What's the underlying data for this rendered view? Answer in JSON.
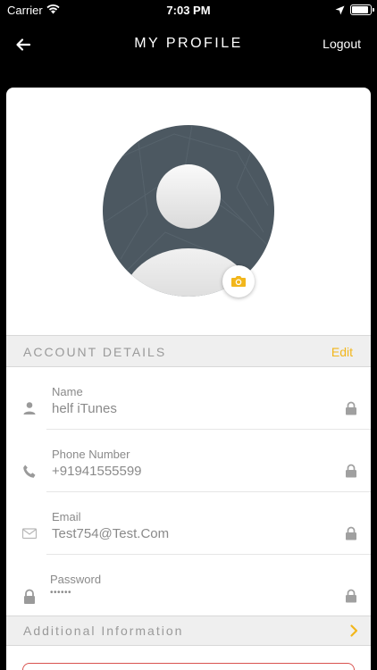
{
  "status_bar": {
    "carrier": "Carrier",
    "time": "7:03 PM",
    "battery_level": 1.0
  },
  "nav": {
    "title": "MY PROFILE",
    "logout_label": "Logout",
    "back_icon": "arrow-left-icon"
  },
  "profile": {
    "avatar_icon": "user-placeholder-avatar",
    "camera_icon": "camera-icon"
  },
  "account_details": {
    "header": "ACCOUNT DETAILS",
    "edit_label": "Edit",
    "fields": [
      {
        "label": "Name",
        "value": "helf iTunes",
        "icon": "person-icon"
      },
      {
        "label": "Phone Number",
        "value": "+91941555599",
        "icon": "phone-icon"
      },
      {
        "label": "Email",
        "value": "Test754@Test.Com",
        "icon": "mail-icon"
      },
      {
        "label": "Password",
        "value": "••••••",
        "icon": "lock-icon"
      }
    ]
  },
  "additional_info": {
    "header": "Additional Information",
    "chevron_icon": "chevron-right-icon"
  },
  "colors": {
    "accent": "#f2b61b",
    "background": "#000000",
    "card": "#ffffff",
    "section_header": "#efefef",
    "muted_text": "#8a8a8a",
    "danger_border": "#d9534f"
  }
}
